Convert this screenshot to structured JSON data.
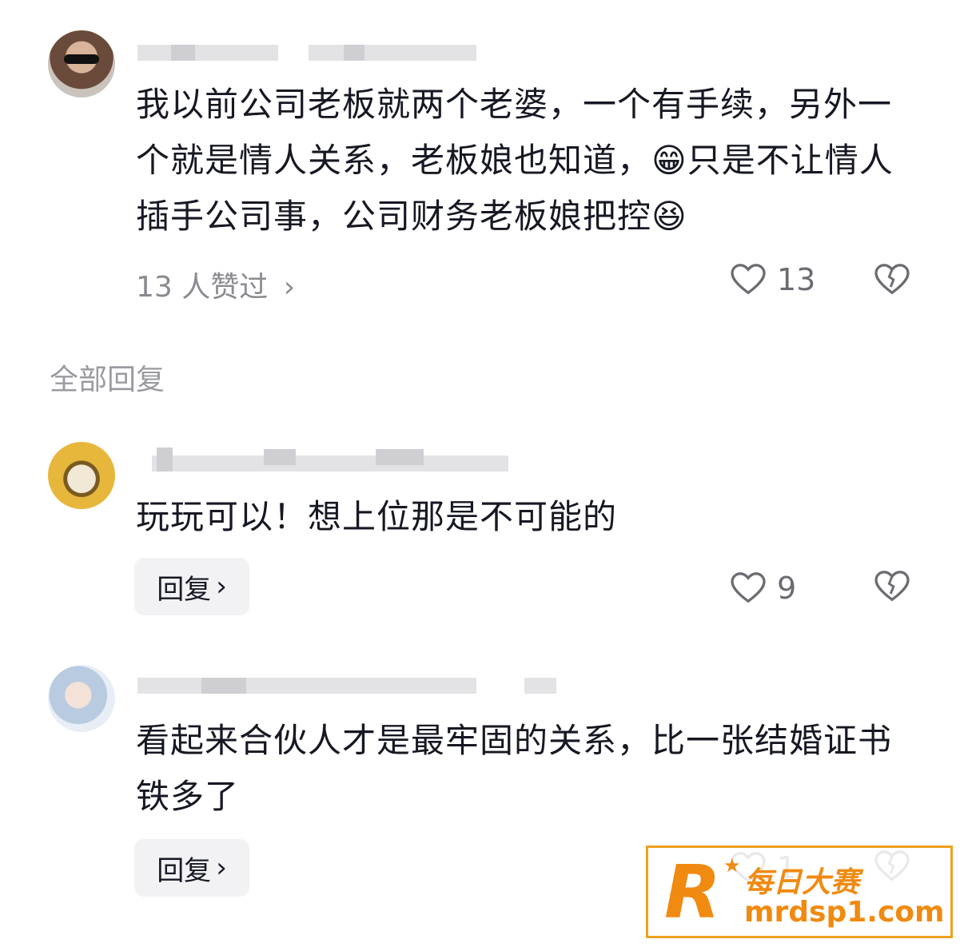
{
  "main_comment": {
    "text": "我以前公司老板就两个老婆，一个有手续，另外一个就是情人关系，老板娘也知道，😁只是不让情人插手公司事，公司财务老板娘把控😆",
    "liked_by": "13 人赞过",
    "likes": "13"
  },
  "section": {
    "title": "全部回复"
  },
  "replies": [
    {
      "text": "玩玩可以！想上位那是不可能的",
      "reply_label": "回复",
      "likes": "9"
    },
    {
      "text": "看起来合伙人才是最牢固的关系，比一张结婚证书铁多了",
      "reply_label": "回复",
      "likes": "1"
    }
  ],
  "watermark": {
    "brand": "每日大赛",
    "url": "mrdsp1.com",
    "logo_letter": "R"
  },
  "colors": {
    "accent": "#f08a10",
    "text": "#161823",
    "muted": "#8a8b91"
  }
}
